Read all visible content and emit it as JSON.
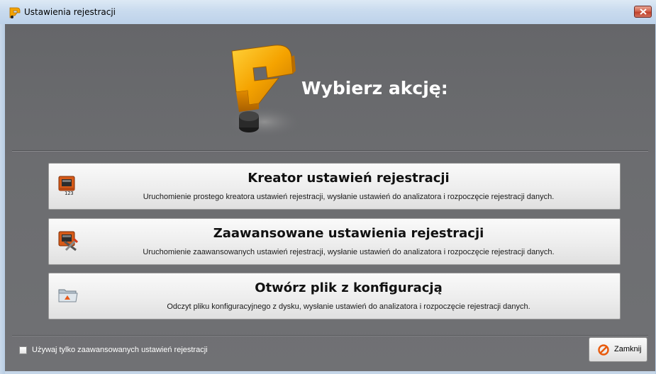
{
  "window": {
    "title": "Ustawienia rejestracji",
    "icon": "app-logo-icon"
  },
  "header": {
    "heading": "Wybierz akcję:",
    "logo": "sonel-logo-icon"
  },
  "actions": [
    {
      "title": "Kreator ustawień rejestracji",
      "description": "Uruchomienie prostego kreatora ustawień rejestracji, wysłanie ustawień do analizatora i rozpoczęcie rejestracji danych.",
      "icon": "wizard-device-icon"
    },
    {
      "title": "Zaawansowane ustawienia rejestracji",
      "description": "Uruchomienie zaawansowanych ustawień rejestracji, wysłanie ustawień do analizatora i rozpoczęcie rejestracji danych.",
      "icon": "advanced-device-tools-icon"
    },
    {
      "title": "Otwórz plik z konfiguracją",
      "description": "Odczyt pliku konfiguracyjnego z dysku, wysłanie ustawień do analizatora i rozpoczęcie rejestracji danych.",
      "icon": "open-folder-icon"
    }
  ],
  "footer": {
    "checkbox_label": "Używaj tylko zaawansowanych ustawień rejestracji",
    "checkbox_checked": false,
    "close_label": "Zamknij",
    "close_icon": "cancel-icon"
  },
  "colors": {
    "accent": "#f5a800",
    "content_bg": "#6c6d70",
    "titlebar": "#c9dbee",
    "close_red": "#c2412a"
  }
}
